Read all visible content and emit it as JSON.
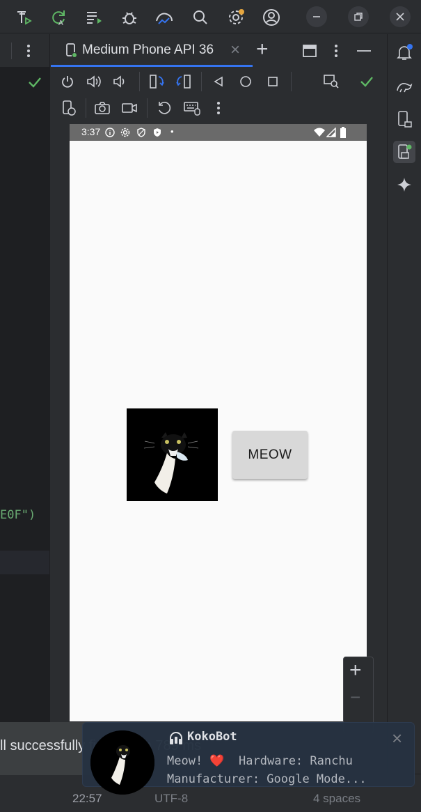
{
  "top_toolbar": {
    "icons": [
      "theme-run-icon",
      "apply-changes-icon",
      "run-list-icon",
      "debug-icon",
      "profiler-icon",
      "search-icon",
      "settings-icon",
      "account-icon",
      "minimize-icon",
      "restore-icon",
      "close-icon"
    ]
  },
  "editor": {
    "code_fragment": "E0F\")"
  },
  "running_devices": {
    "tab_label": "Medium Phone API 36",
    "tab_close": "×",
    "add_tab": "+"
  },
  "emulator": {
    "status_time": "3:37",
    "status_dot": "•",
    "app": {
      "button_label": "MEOW"
    },
    "zoom": {
      "plus": "+",
      "minus": "−"
    }
  },
  "toast": {
    "message": "ll successfully finished in 789 ms"
  },
  "status_bar": {
    "position": "22:57",
    "encoding": "UTF-8",
    "indent": "4 spaces"
  },
  "notification": {
    "title": "KokoBot",
    "line1": "Meow! ❤️  Hardware: Ranchu",
    "line2": "Manufacturer: Google Mode...",
    "close": "×"
  },
  "colors": {
    "accent": "#3574f0",
    "check": "#5fb865",
    "notif_bg": "#263241",
    "emulator_bg": "#fafafa"
  }
}
